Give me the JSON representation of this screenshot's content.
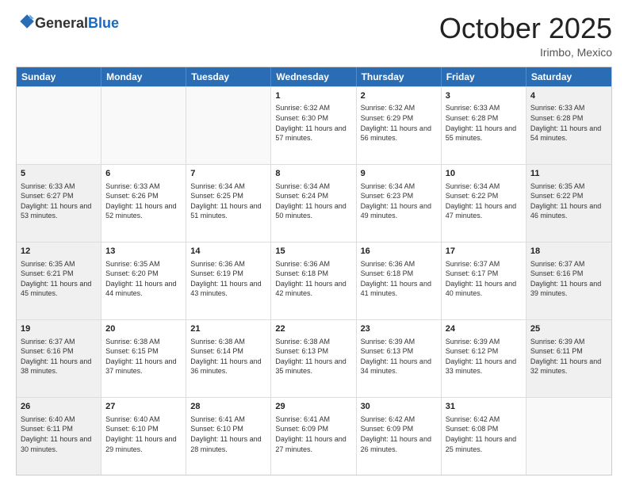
{
  "header": {
    "logo_general": "General",
    "logo_blue": "Blue",
    "month": "October 2025",
    "location": "Irimbo, Mexico"
  },
  "days_of_week": [
    "Sunday",
    "Monday",
    "Tuesday",
    "Wednesday",
    "Thursday",
    "Friday",
    "Saturday"
  ],
  "rows": [
    [
      {
        "day": "",
        "empty": true
      },
      {
        "day": "",
        "empty": true
      },
      {
        "day": "",
        "empty": true
      },
      {
        "day": "1",
        "sunrise": "Sunrise: 6:32 AM",
        "sunset": "Sunset: 6:30 PM",
        "daylight": "Daylight: 11 hours and 57 minutes."
      },
      {
        "day": "2",
        "sunrise": "Sunrise: 6:32 AM",
        "sunset": "Sunset: 6:29 PM",
        "daylight": "Daylight: 11 hours and 56 minutes."
      },
      {
        "day": "3",
        "sunrise": "Sunrise: 6:33 AM",
        "sunset": "Sunset: 6:28 PM",
        "daylight": "Daylight: 11 hours and 55 minutes."
      },
      {
        "day": "4",
        "sunrise": "Sunrise: 6:33 AM",
        "sunset": "Sunset: 6:28 PM",
        "daylight": "Daylight: 11 hours and 54 minutes."
      }
    ],
    [
      {
        "day": "5",
        "sunrise": "Sunrise: 6:33 AM",
        "sunset": "Sunset: 6:27 PM",
        "daylight": "Daylight: 11 hours and 53 minutes."
      },
      {
        "day": "6",
        "sunrise": "Sunrise: 6:33 AM",
        "sunset": "Sunset: 6:26 PM",
        "daylight": "Daylight: 11 hours and 52 minutes."
      },
      {
        "day": "7",
        "sunrise": "Sunrise: 6:34 AM",
        "sunset": "Sunset: 6:25 PM",
        "daylight": "Daylight: 11 hours and 51 minutes."
      },
      {
        "day": "8",
        "sunrise": "Sunrise: 6:34 AM",
        "sunset": "Sunset: 6:24 PM",
        "daylight": "Daylight: 11 hours and 50 minutes."
      },
      {
        "day": "9",
        "sunrise": "Sunrise: 6:34 AM",
        "sunset": "Sunset: 6:23 PM",
        "daylight": "Daylight: 11 hours and 49 minutes."
      },
      {
        "day": "10",
        "sunrise": "Sunrise: 6:34 AM",
        "sunset": "Sunset: 6:22 PM",
        "daylight": "Daylight: 11 hours and 47 minutes."
      },
      {
        "day": "11",
        "sunrise": "Sunrise: 6:35 AM",
        "sunset": "Sunset: 6:22 PM",
        "daylight": "Daylight: 11 hours and 46 minutes."
      }
    ],
    [
      {
        "day": "12",
        "sunrise": "Sunrise: 6:35 AM",
        "sunset": "Sunset: 6:21 PM",
        "daylight": "Daylight: 11 hours and 45 minutes."
      },
      {
        "day": "13",
        "sunrise": "Sunrise: 6:35 AM",
        "sunset": "Sunset: 6:20 PM",
        "daylight": "Daylight: 11 hours and 44 minutes."
      },
      {
        "day": "14",
        "sunrise": "Sunrise: 6:36 AM",
        "sunset": "Sunset: 6:19 PM",
        "daylight": "Daylight: 11 hours and 43 minutes."
      },
      {
        "day": "15",
        "sunrise": "Sunrise: 6:36 AM",
        "sunset": "Sunset: 6:18 PM",
        "daylight": "Daylight: 11 hours and 42 minutes."
      },
      {
        "day": "16",
        "sunrise": "Sunrise: 6:36 AM",
        "sunset": "Sunset: 6:18 PM",
        "daylight": "Daylight: 11 hours and 41 minutes."
      },
      {
        "day": "17",
        "sunrise": "Sunrise: 6:37 AM",
        "sunset": "Sunset: 6:17 PM",
        "daylight": "Daylight: 11 hours and 40 minutes."
      },
      {
        "day": "18",
        "sunrise": "Sunrise: 6:37 AM",
        "sunset": "Sunset: 6:16 PM",
        "daylight": "Daylight: 11 hours and 39 minutes."
      }
    ],
    [
      {
        "day": "19",
        "sunrise": "Sunrise: 6:37 AM",
        "sunset": "Sunset: 6:16 PM",
        "daylight": "Daylight: 11 hours and 38 minutes."
      },
      {
        "day": "20",
        "sunrise": "Sunrise: 6:38 AM",
        "sunset": "Sunset: 6:15 PM",
        "daylight": "Daylight: 11 hours and 37 minutes."
      },
      {
        "day": "21",
        "sunrise": "Sunrise: 6:38 AM",
        "sunset": "Sunset: 6:14 PM",
        "daylight": "Daylight: 11 hours and 36 minutes."
      },
      {
        "day": "22",
        "sunrise": "Sunrise: 6:38 AM",
        "sunset": "Sunset: 6:13 PM",
        "daylight": "Daylight: 11 hours and 35 minutes."
      },
      {
        "day": "23",
        "sunrise": "Sunrise: 6:39 AM",
        "sunset": "Sunset: 6:13 PM",
        "daylight": "Daylight: 11 hours and 34 minutes."
      },
      {
        "day": "24",
        "sunrise": "Sunrise: 6:39 AM",
        "sunset": "Sunset: 6:12 PM",
        "daylight": "Daylight: 11 hours and 33 minutes."
      },
      {
        "day": "25",
        "sunrise": "Sunrise: 6:39 AM",
        "sunset": "Sunset: 6:11 PM",
        "daylight": "Daylight: 11 hours and 32 minutes."
      }
    ],
    [
      {
        "day": "26",
        "sunrise": "Sunrise: 6:40 AM",
        "sunset": "Sunset: 6:11 PM",
        "daylight": "Daylight: 11 hours and 30 minutes."
      },
      {
        "day": "27",
        "sunrise": "Sunrise: 6:40 AM",
        "sunset": "Sunset: 6:10 PM",
        "daylight": "Daylight: 11 hours and 29 minutes."
      },
      {
        "day": "28",
        "sunrise": "Sunrise: 6:41 AM",
        "sunset": "Sunset: 6:10 PM",
        "daylight": "Daylight: 11 hours and 28 minutes."
      },
      {
        "day": "29",
        "sunrise": "Sunrise: 6:41 AM",
        "sunset": "Sunset: 6:09 PM",
        "daylight": "Daylight: 11 hours and 27 minutes."
      },
      {
        "day": "30",
        "sunrise": "Sunrise: 6:42 AM",
        "sunset": "Sunset: 6:09 PM",
        "daylight": "Daylight: 11 hours and 26 minutes."
      },
      {
        "day": "31",
        "sunrise": "Sunrise: 6:42 AM",
        "sunset": "Sunset: 6:08 PM",
        "daylight": "Daylight: 11 hours and 25 minutes."
      },
      {
        "day": "",
        "empty": true
      }
    ]
  ]
}
